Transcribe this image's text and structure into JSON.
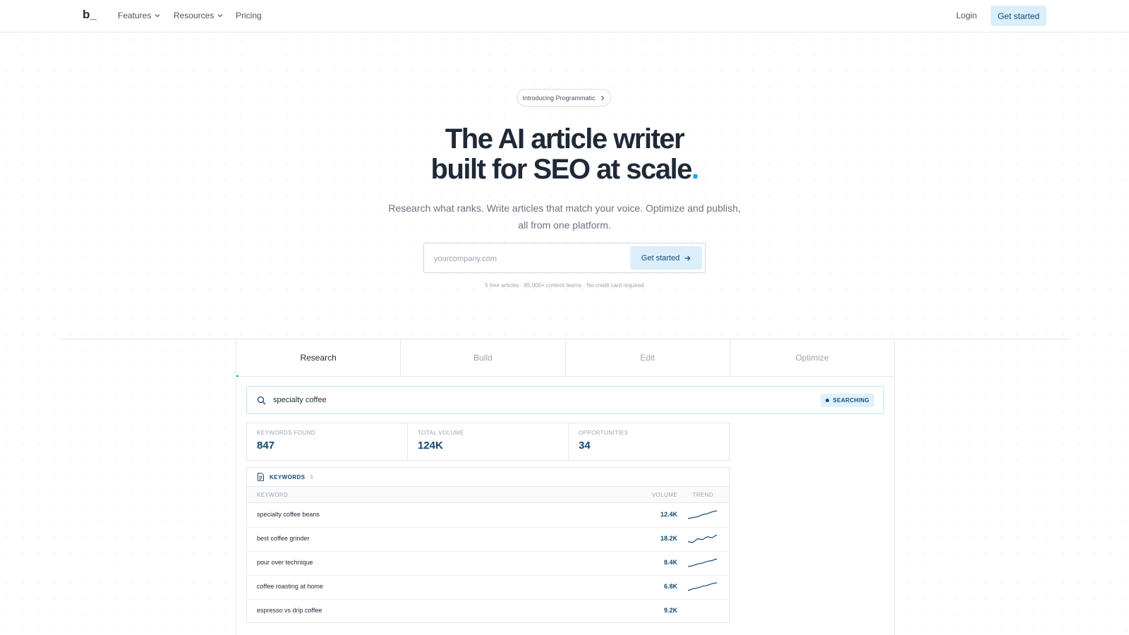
{
  "nav": {
    "logo": "b_",
    "items": [
      {
        "label": "Features",
        "has_dropdown": true
      },
      {
        "label": "Resources",
        "has_dropdown": true
      },
      {
        "label": "Pricing",
        "has_dropdown": false
      }
    ],
    "login": "Login",
    "cta": "Get started"
  },
  "hero": {
    "pill": "Introducing Programmatic",
    "headline_line1": "The AI article writer",
    "headline_line2": "built for SEO at scale",
    "headline_accent": ".",
    "subhead": "Research what ranks. Write articles that match your voice. Optimize and publish, all from one platform.",
    "email_placeholder": "yourcompany.com",
    "email_cta": "Get started",
    "fine_print": "5 free articles · 85,000+ content teams · No credit card required"
  },
  "panel": {
    "tabs": [
      "Research",
      "Build",
      "Edit",
      "Optimize"
    ],
    "active_tab": "Research",
    "search_query": "specialty coffee",
    "status_badge": "SEARCHING",
    "stats": [
      {
        "label": "KEYWORDS FOUND",
        "value": "847"
      },
      {
        "label": "TOTAL VOLUME",
        "value": "124K"
      },
      {
        "label": "OPPORTUNITIES",
        "value": "34"
      }
    ],
    "keywords": {
      "title": "KEYWORDS",
      "count": "5",
      "col_keyword": "KEYWORD",
      "col_volume": "VOLUME",
      "col_trend": "TREND",
      "rows": [
        {
          "keyword": "specialty coffee beans",
          "volume": "12.4K",
          "trend": [
            2,
            3,
            4,
            6,
            7,
            9,
            10
          ]
        },
        {
          "keyword": "best coffee grinder",
          "volume": "18.2K",
          "trend": [
            3,
            2,
            6,
            5,
            8,
            7,
            10
          ]
        },
        {
          "keyword": "pour over technique",
          "volume": "8.4K",
          "trend": [
            1,
            2,
            4,
            5,
            7,
            8,
            10
          ]
        },
        {
          "keyword": "coffee roasting at home",
          "volume": "6.8K",
          "trend": [
            1,
            3,
            4,
            6,
            7,
            9,
            10
          ]
        },
        {
          "keyword": "espresso vs drip coffee",
          "volume": "9.2K",
          "trend": []
        }
      ]
    }
  },
  "colors": {
    "brand_dark": "#0f4c75",
    "accent": "#0ea5e9",
    "cta_bg": "#dbeefb"
  }
}
